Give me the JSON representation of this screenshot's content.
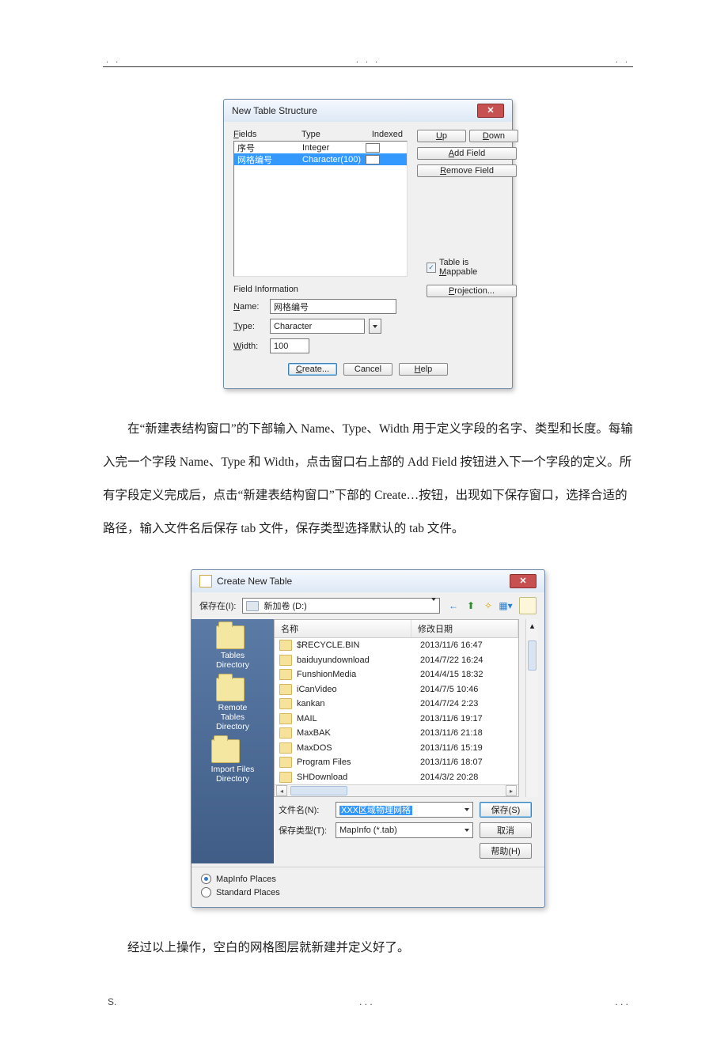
{
  "header": {
    "dots_left": ". .",
    "dots_mid": ".  . .",
    "dots_right": ".   ."
  },
  "footer": {
    "left": "S.",
    "mid": ".  .  .",
    "right": ".  .  ."
  },
  "dlg1": {
    "title": "New Table Structure",
    "heads": {
      "fields": "Fields",
      "type": "Type",
      "indexed": "Indexed"
    },
    "rows": [
      {
        "name": "序号",
        "type": "Integer"
      },
      {
        "name": "网格编号",
        "type": "Character(100)"
      }
    ],
    "btns": {
      "up": "Up",
      "down": "Down",
      "add": "Add Field",
      "remove": "Remove Field"
    },
    "field_info_label": "Field Information",
    "name_label": "Name:",
    "name_value": "网格编号",
    "type_label": "Type:",
    "type_value": "Character",
    "width_label": "Width:",
    "width_value": "100",
    "mappable": "Table is Mappable",
    "projection": "Projection...",
    "create": "Create...",
    "cancel": "Cancel",
    "help": "Help"
  },
  "para1": "在“新建表结构窗口”的下部输入 Name、Type、Width 用于定义字段的名字、类型和长度。每输入完一个字段 Name、Type 和 Width，点击窗口右上部的 Add Field  按钮进入下一个字段的定义。所有字段定义完成后，点击“新建表结构窗口”下部的 Create…按钮，出现如下保存窗口，选择合适的路径，输入文件名后保存 tab 文件，保存类型选择默认的 tab 文件。",
  "dlg2": {
    "title": "Create New Table",
    "save_in_label": "保存在(I):",
    "drive": "新加卷 (D:)",
    "list_head": {
      "name": "名称",
      "date": "修改日期"
    },
    "sidebar": [
      "Tables\nDirectory",
      "Remote\nTables\nDirectory",
      "Import Files\nDirectory"
    ],
    "files": [
      {
        "n": "$RECYCLE.BIN",
        "d": "2013/11/6 16:47"
      },
      {
        "n": "baiduyundownload",
        "d": "2014/7/22 16:24"
      },
      {
        "n": "FunshionMedia",
        "d": "2014/4/15 18:32"
      },
      {
        "n": "iCanVideo",
        "d": "2014/7/5 10:46"
      },
      {
        "n": "kankan",
        "d": "2014/7/24 2:23"
      },
      {
        "n": "MAIL",
        "d": "2013/11/6 19:17"
      },
      {
        "n": "MaxBAK",
        "d": "2013/11/6 21:18"
      },
      {
        "n": "MaxDOS",
        "d": "2013/11/6 15:19"
      },
      {
        "n": "Program Files",
        "d": "2013/11/6 18:07"
      },
      {
        "n": "SHDownload",
        "d": "2014/3/2 20:28"
      }
    ],
    "fn_label": "文件名(N):",
    "fn_value": "XXX区域物理网格",
    "ft_label": "保存类型(T):",
    "ft_value": "MapInfo (*.tab)",
    "save": "保存(S)",
    "cancel": "取消",
    "help": "帮助(H)",
    "radio_mapinfo": "MapInfo Places",
    "radio_standard": "Standard Places"
  },
  "para2": "经过以上操作，空白的网格图层就新建并定义好了。"
}
